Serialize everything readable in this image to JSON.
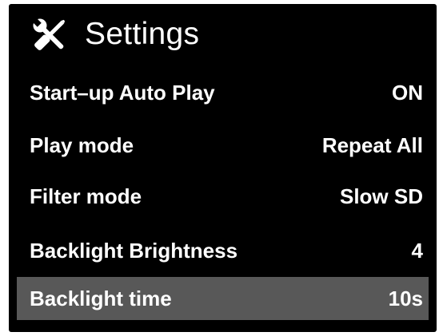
{
  "header": {
    "title": "Settings",
    "icon": "wrench-screwdriver-icon"
  },
  "settings": [
    {
      "label": "Start–up Auto Play",
      "value": "ON",
      "selected": false
    },
    {
      "label": "Play mode",
      "value": "Repeat All",
      "selected": false
    },
    {
      "label": "Filter mode",
      "value": "Slow SD",
      "selected": false
    },
    {
      "label": "Backlight Brightness",
      "value": "4",
      "selected": false
    },
    {
      "label": "Backlight time",
      "value": "10s",
      "selected": true
    }
  ],
  "colors": {
    "screen_background": "#000000",
    "text": "#ffffff",
    "selection_highlight": "#585858"
  }
}
